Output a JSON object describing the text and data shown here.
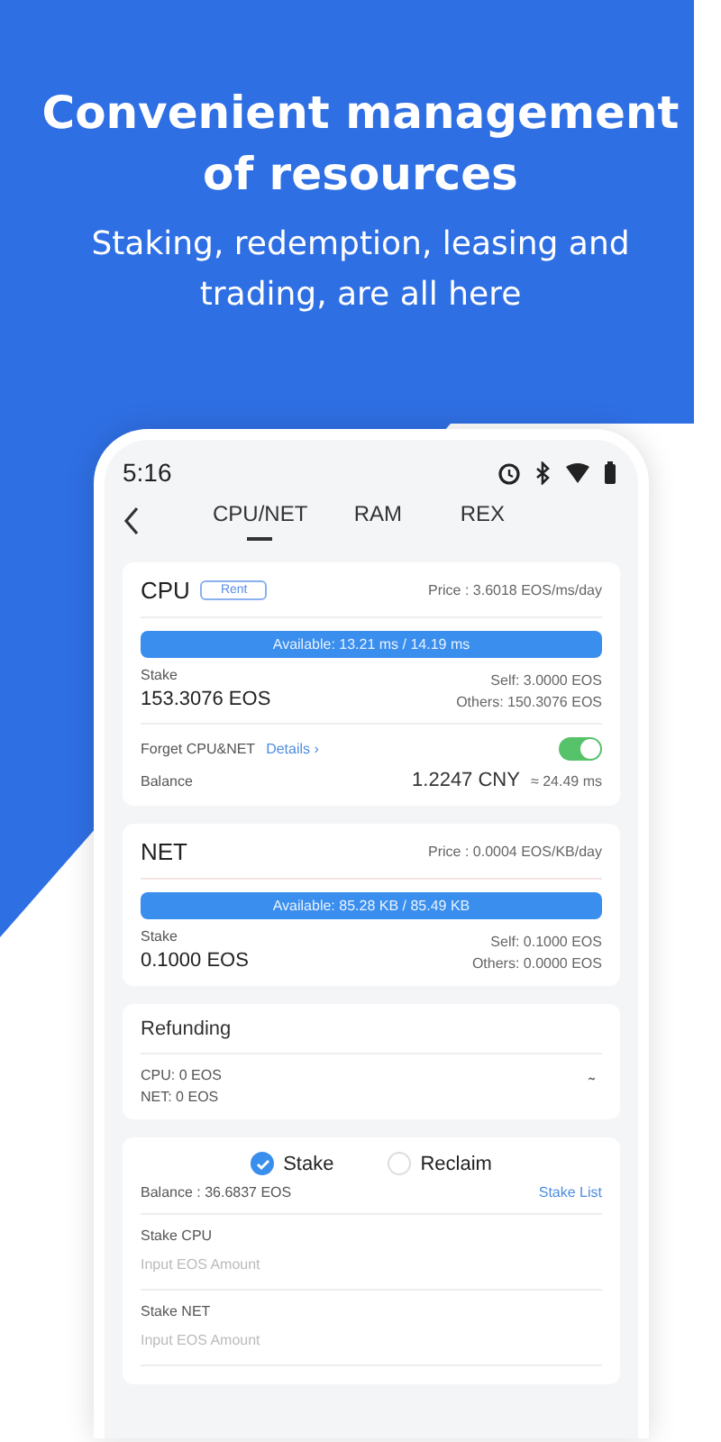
{
  "headline": "Convenient management of resources",
  "subtitle": "Staking, redemption, leasing and trading, are all here",
  "status_bar": {
    "time": "5:16"
  },
  "tabs": [
    {
      "label": "CPU/NET",
      "selected": true
    },
    {
      "label": "RAM",
      "selected": false
    },
    {
      "label": "REX",
      "selected": false
    }
  ],
  "cpu": {
    "title": "CPU",
    "rent_button": "Rent",
    "price": "Price : 3.6018 EOS/ms/day",
    "available": "Available: 13.21 ms / 14.19 ms",
    "stake_label": "Stake",
    "stake_value": "153.3076 EOS",
    "self": "Self: 3.0000 EOS",
    "others": "Others: 150.3076 EOS",
    "forget_label": "Forget CPU&NET",
    "details_link": "Details ›",
    "forget_on": true,
    "balance_label": "Balance",
    "balance_value": "1.2247 CNY",
    "balance_equiv": "≈ 24.49 ms"
  },
  "net": {
    "title": "NET",
    "price": "Price : 0.0004 EOS/KB/day",
    "available": "Available: 85.28 KB / 85.49 KB",
    "stake_label": "Stake",
    "stake_value": "0.1000 EOS",
    "self": "Self: 0.1000 EOS",
    "others": "Others: 0.0000 EOS"
  },
  "refunding": {
    "title": "Refunding",
    "cpu": "CPU: 0 EOS",
    "net": "NET: 0 EOS",
    "toggle": "˜"
  },
  "stake_form": {
    "options": [
      {
        "label": "Stake",
        "selected": true
      },
      {
        "label": "Reclaim",
        "selected": false
      }
    ],
    "balance": "Balance : 36.6837 EOS",
    "stake_list_link": "Stake List",
    "fields": [
      {
        "label": "Stake CPU",
        "placeholder": "Input EOS Amount"
      },
      {
        "label": "Stake NET",
        "placeholder": "Input EOS Amount"
      }
    ]
  }
}
